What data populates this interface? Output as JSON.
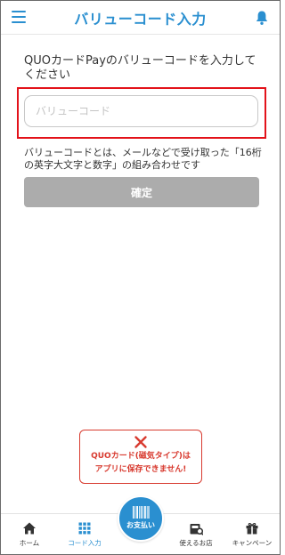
{
  "header": {
    "title": "バリューコード入力"
  },
  "main": {
    "instruction": "QUOカードPayのバリューコードを入力してください",
    "input": {
      "placeholder": "バリューコード",
      "value": ""
    },
    "note": "バリューコードとは、メールなどで受け取った「16桁の英字大文字と数字」の組み合わせです",
    "confirm_label": "確定"
  },
  "warning": {
    "line1": "QUOカード(磁気タイプ)は",
    "line2": "アプリに保存できません!"
  },
  "bottom_nav": {
    "home": "ホーム",
    "code_input": "コード入力",
    "pay": "お支払い",
    "shops": "使えるお店",
    "campaign": "キャンペーン"
  },
  "colors": {
    "accent": "#2a8fd0",
    "highlight_border": "#e3121a",
    "warning": "#d83a2f",
    "disabled_button": "#acacac"
  },
  "icons": [
    "menu-icon",
    "bell-icon",
    "x-icon",
    "home-icon",
    "grid-icon",
    "barcode-icon",
    "shop-icon",
    "gift-icon"
  ]
}
